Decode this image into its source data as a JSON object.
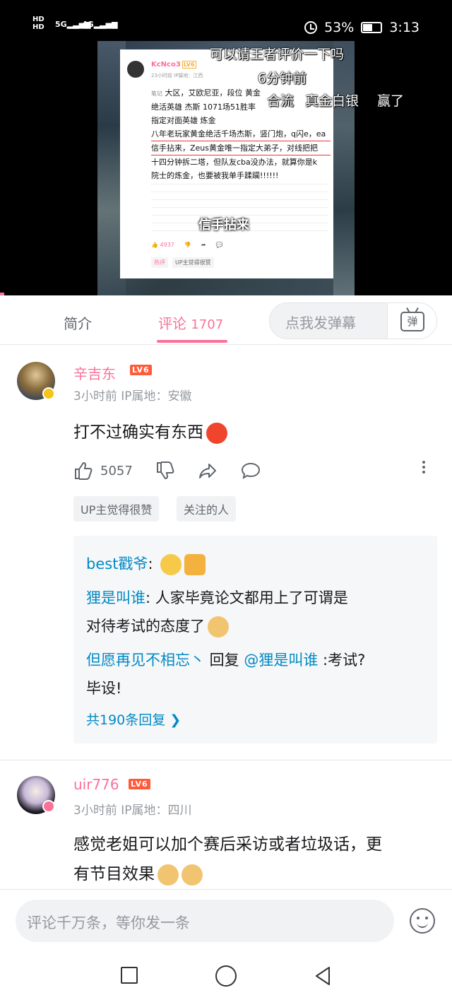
{
  "status_bar": {
    "network_left": "HD",
    "sig1": "5G",
    "sig2": "4G",
    "battery": "53%",
    "time": "3:13"
  },
  "video": {
    "danmaku": [
      "可以请王者评价一下吗",
      "6分钟前",
      "合流",
      "真金白银",
      "赢了"
    ],
    "subtitle": "信手拈来",
    "card": {
      "username": "KcNco3",
      "level": "LV6",
      "meta": "23小时前  IP属地：江西",
      "note_label": "笔记",
      "lines": [
        "大区，艾欧尼亚，段位 黄金",
        "绝活英雄 杰斯 1071场51胜率",
        "指定对面英雄 炼金",
        "八年老玩家黄金绝活千场杰斯，竖门炮，q闪e，ea",
        "信手拈来，Zeus黄金唯一指定大弟子，对线把把",
        "十四分钟拆二塔，但队友cba没办法，就算你是k",
        "院士的炼金，也要被我单手蹂躏!!!!!!"
      ],
      "likes": "4937",
      "tags": [
        "热评",
        "UP主觉得很赞"
      ]
    }
  },
  "tabs": {
    "intro": "简介",
    "comments": "评论",
    "comments_count": "1707",
    "danmaku_placeholder": "点我发弹幕",
    "danmaku_btn": "弹"
  },
  "comments": [
    {
      "name": "辛吉东",
      "level": "LV6",
      "time": "3小时前  IP属地：安徽",
      "text": "打不过确实有东西",
      "likes": "5057",
      "tags": [
        "UP主觉得很赞",
        "关注的人"
      ],
      "replies": [
        {
          "name": "best戳爷",
          "text": ":"
        },
        {
          "name": "狸是叫谁",
          "text": ": 人家毕竟论文都用上了可谓是"
        },
        {
          "name": "",
          "text": "对待考试的态度了"
        },
        {
          "name": "但愿再见不相忘丶",
          "text": " 回复 "
        },
        {
          "name": "@狸是叫谁",
          "text": " :考试?"
        },
        {
          "name": "",
          "text": "毕设!"
        }
      ],
      "more": "共190条回复"
    },
    {
      "name": "uir776",
      "level": "LV6",
      "time": "3小时前  IP属地：四川",
      "text1": "感觉老姐可以加个赛后采访或者垃圾话，更",
      "text2": "有节目效果"
    }
  ],
  "comment_input": {
    "placeholder": "评论千万条，等你发一条"
  }
}
